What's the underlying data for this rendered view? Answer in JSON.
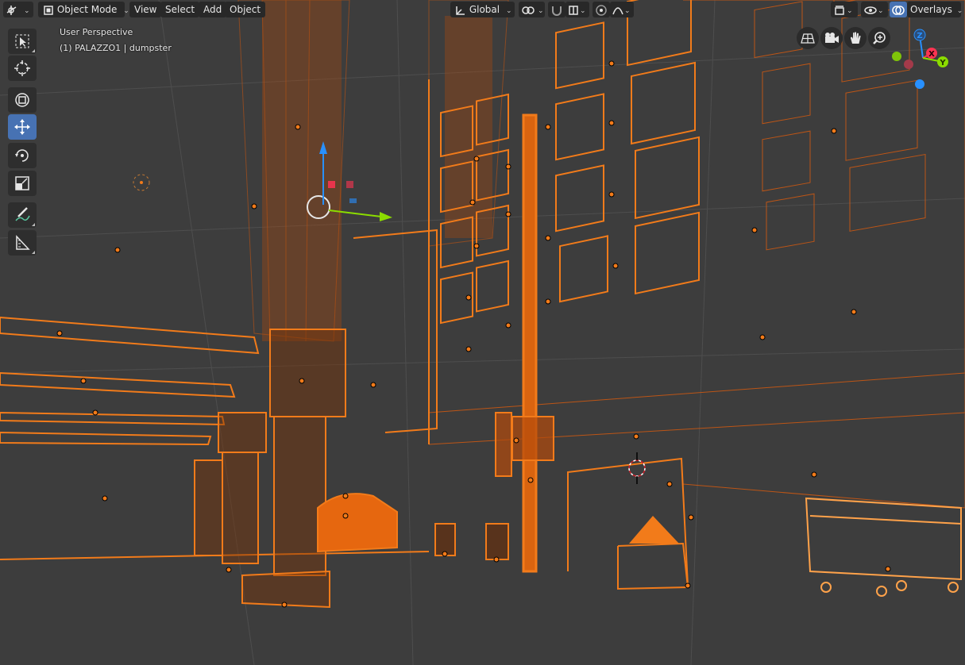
{
  "header": {
    "editor_type_icon": "3d-viewport-icon",
    "mode": "Object Mode",
    "menus": [
      "View",
      "Select",
      "Add",
      "Object"
    ],
    "transform_orientation": "Global",
    "pivot_icon": "pivot-icon",
    "snap_icon": "magnet-icon",
    "proportional_icon": "proportional-edit-icon",
    "overlays_label": "Overlays",
    "colors": {
      "header_bg": "#282828",
      "accent": "#4772b3",
      "viewport_bg": "#3d3d3d",
      "selection": "#f27b1a"
    }
  },
  "viewport": {
    "perspective_label": "User Perspective",
    "object_label": "(1) PALAZZO1 | dumpster"
  },
  "toolbar": {
    "tools": [
      {
        "name": "select-box",
        "icon": "select-box-icon",
        "active": false
      },
      {
        "name": "cursor",
        "icon": "cursor-icon",
        "active": false
      },
      {
        "name": "transform",
        "icon": "transform-icon",
        "active": false
      },
      {
        "name": "move",
        "icon": "move-icon",
        "active": true
      },
      {
        "name": "rotate",
        "icon": "rotate-icon",
        "active": false
      },
      {
        "name": "scale",
        "icon": "scale-icon",
        "active": false
      },
      {
        "name": "annotate",
        "icon": "annotate-icon",
        "active": false
      },
      {
        "name": "measure",
        "icon": "measure-icon",
        "active": false
      }
    ]
  },
  "navigation": {
    "buttons": [
      "perspective-toggle-icon",
      "camera-view-icon",
      "pan-hand-icon",
      "zoom-icon"
    ],
    "gizmo_axes": [
      "Z",
      "X",
      "Y"
    ],
    "axis_colors": {
      "x": "#ff3352",
      "y": "#8bdc00",
      "z": "#2890ff"
    }
  }
}
